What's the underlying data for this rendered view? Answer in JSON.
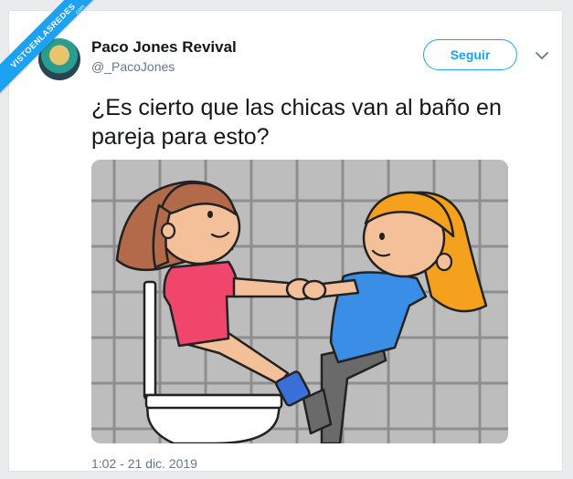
{
  "watermark": {
    "text": "VISTOENLASREDES",
    "sub": ".com"
  },
  "author": {
    "name": "Paco Jones Revival",
    "handle": "@_PacoJones"
  },
  "follow": {
    "label": "Seguir"
  },
  "menu": {
    "icon": "chevron-down-icon"
  },
  "tweet": {
    "text": "¿Es cierto que las chicas van al baño en pareja para esto?",
    "timestamp": "1:02 - 21 dic. 2019"
  },
  "media": {
    "description": "",
    "colors": {
      "tile": "#bdbdbd",
      "grout": "#8e8e8e",
      "pink_shirt": "#f0466b",
      "blue_shirt": "#3a8ee6",
      "orange_hair": "#f6a11d",
      "brown_hair": "#b36a4b"
    }
  },
  "colors": {
    "accent": "#1da1f2",
    "text": "#14171a",
    "muted": "#657786"
  }
}
